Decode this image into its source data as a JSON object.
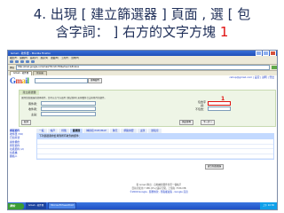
{
  "slide": {
    "title_line1": "4. 出現 [ 建立篩選器 ] 頁面 , 選 [ 包",
    "title_line2_prefix": "含字詞： ] 右方的文字方塊 ",
    "title_line2_number": "1"
  },
  "browser": {
    "window_title": "Gmail - 收件匣 - Mozilla Firefox",
    "menu": [
      "檔案(F)",
      "編輯(E)",
      "檢視(V)",
      "歷史(S)",
      "書籤(B)",
      "工具(T)",
      "說明(H)"
    ],
    "address_label": "網址",
    "url": "http://mail.google.com/mail/?hl=zh-TW&shva=1#inbox",
    "tabs": [
      "Gmail - 收件匣",
      "新分頁"
    ]
  },
  "gmail": {
    "logo_letters": [
      "G",
      "m",
      "a",
      "i",
      "l"
    ],
    "search_button": "搜尋郵件",
    "top_links": "cshop@gmail.com | 設定 | 說明 | 登出",
    "filter": {
      "header": "建立篩選器",
      "description": "選擇您篩選器的搜尋條件。您可以在下方使用 [測試搜尋] 來預覽符合這些條件的郵件。",
      "fields_left": [
        "寄件者：",
        "收件者：",
        "主旨："
      ],
      "fields_right": [
        "包含字詞：",
        "不包含："
      ],
      "cancel_button": "取消",
      "test_button": "測試搜尋",
      "next_button": "下一步 »"
    },
    "marker": "1",
    "sidebar": [
      "撰寫郵件",
      "收件匣 (59)",
      "已加星號",
      "寄件備份",
      "所有郵件",
      "垃圾郵件 (2)",
      "垃圾桶",
      "聯絡人"
    ],
    "mail_tabs": [
      "一般",
      "帳戶",
      "標籤",
      "篩選器",
      "轉寄和 POP/IMAP",
      "聊天",
      "網路摘要",
      "主題",
      "實驗室"
    ],
    "mail_sub": "下列篩選器會套用到所有收到的郵件：",
    "mail_button": "建立新篩選器",
    "footer_lines": [
      "從 Gmail 匯出：自動轉寄郵件到另一個帳戶",
      "目前共使用 7 MB (0%) 儲存空間，上限為 7336 MB",
      "©2009 Google - 服務條款 - 隱私權政策 - Google 首頁"
    ]
  },
  "taskbar": {
    "start": "開始",
    "tasks": [
      "Gmail - 收件匣",
      "Microsoft PowerPoint"
    ],
    "clock": "上午 10:30"
  }
}
